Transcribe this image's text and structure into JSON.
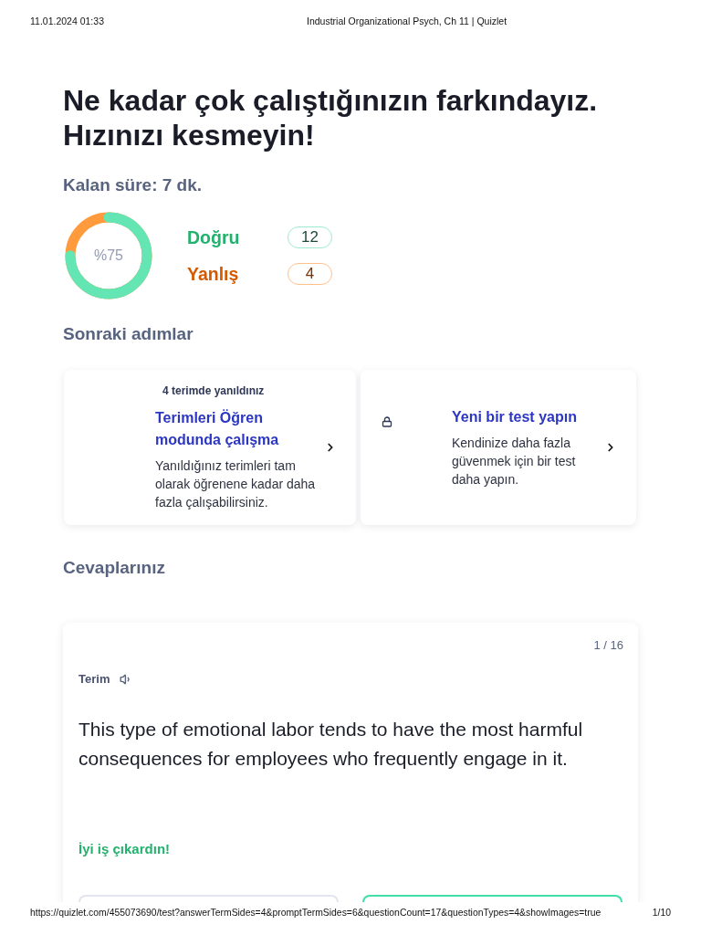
{
  "print_header": {
    "date": "11.01.2024 01:33",
    "title": "Industrial Organizational Psych, Ch 11 | Quizlet"
  },
  "heading": "Ne kadar çok çalıştığınızın farkındayız. Hızınızı kesmeyin!",
  "time_left": "Kalan süre: 7 dk.",
  "score": {
    "percent_label": "%75",
    "level": 0.75,
    "results": [
      {
        "kind": "correct",
        "label": "Doğru",
        "count": "12"
      },
      {
        "kind": "incorrect",
        "label": "Yanlış",
        "count": "4"
      }
    ]
  },
  "next_steps": {
    "title": "Sonraki adımlar",
    "cards": [
      {
        "note": "4 terimde yanıldınız",
        "locked": false,
        "title": "Terimleri Öğren modunda çalışma",
        "description": "Yanıldığınız terimleri tam olarak öğrenene kadar daha fazla çalışabilirsiniz."
      },
      {
        "locked": true,
        "title": "Yeni bir test yapın",
        "description": "Kendinize daha fazla güvenmek için bir test daha yapın."
      }
    ]
  },
  "answers": {
    "title": "Cevaplarınız",
    "question": {
      "counter": "1 / 16",
      "side_label": "Terim",
      "prompt": "This type of emotional labor tends to have the most harmful consequences for employees who frequently engage in it.",
      "feedback": "İyi iş çıkardın!",
      "options": [
        {
          "selected": false
        },
        {
          "selected": true
        }
      ]
    }
  },
  "print_footer": {
    "url": "https://quizlet.com/455073690/test?answerTermSides=4&promptTermSides=6&questionCount=17&questionTypes=4&showImages=true",
    "page": "1/10"
  }
}
